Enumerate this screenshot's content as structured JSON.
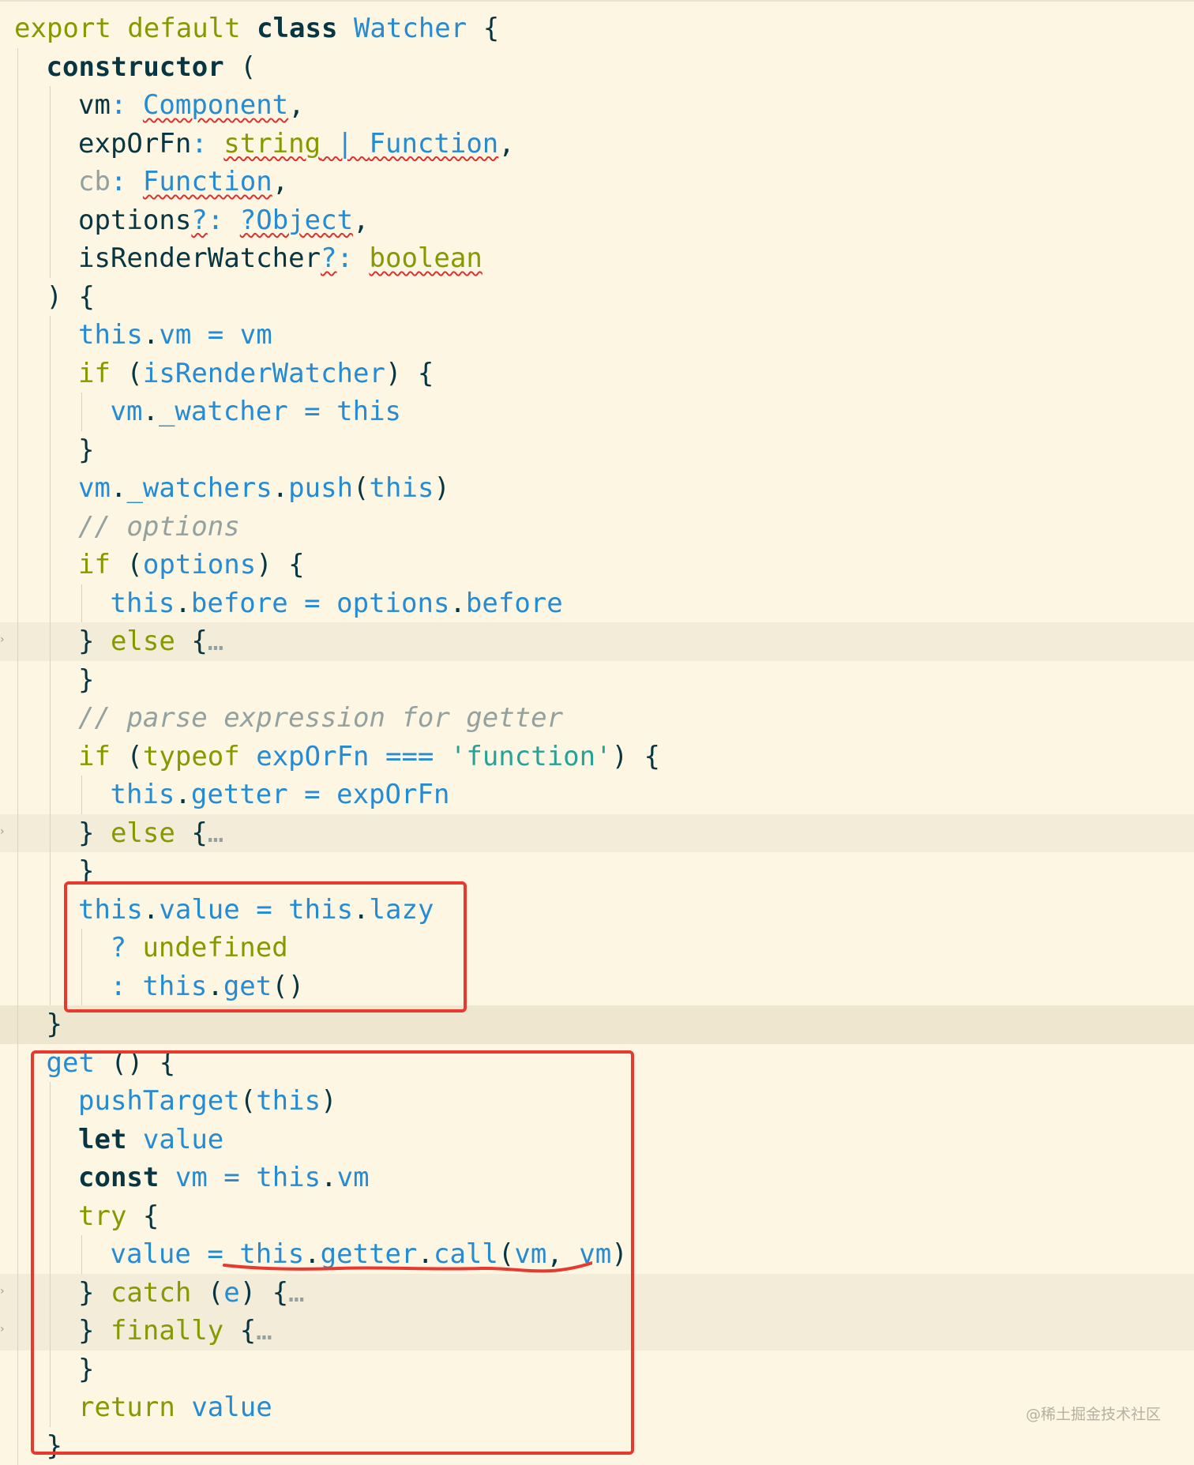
{
  "editor": {
    "language": "JavaScript (Flow)",
    "theme_background": "#fdf6e3",
    "lines": [
      {
        "n": 1,
        "indent": 0,
        "tokens": [
          [
            "kw",
            "export"
          ],
          [
            "pl",
            " "
          ],
          [
            "kw",
            "default"
          ],
          [
            "pl",
            " "
          ],
          [
            "bld",
            "class"
          ],
          [
            "pl",
            " "
          ],
          [
            "ty",
            "Watcher"
          ],
          [
            "pl",
            " {"
          ]
        ]
      },
      {
        "n": 2,
        "indent": 1,
        "tokens": [
          [
            "bld",
            "constructor"
          ],
          [
            "pl",
            " ("
          ]
        ]
      },
      {
        "n": 3,
        "indent": 2,
        "tokens": [
          [
            "pl",
            "vm"
          ],
          [
            "op",
            ":"
          ],
          [
            "pl",
            " "
          ],
          [
            "ty",
            "Component",
            "sq"
          ],
          [
            "pl",
            ","
          ]
        ]
      },
      {
        "n": 4,
        "indent": 2,
        "tokens": [
          [
            "pl",
            "expOrFn"
          ],
          [
            "op",
            ":"
          ],
          [
            "pl",
            " "
          ],
          [
            "yel",
            "string",
            "sq"
          ],
          [
            "op",
            " | ",
            "sq"
          ],
          [
            "ty",
            "Function",
            "sq"
          ],
          [
            "pl",
            ","
          ]
        ]
      },
      {
        "n": 5,
        "indent": 2,
        "tokens": [
          [
            "dim",
            "cb"
          ],
          [
            "op",
            ":"
          ],
          [
            "pl",
            " "
          ],
          [
            "ty",
            "Function",
            "sq"
          ],
          [
            "pl",
            ","
          ]
        ]
      },
      {
        "n": 6,
        "indent": 2,
        "tokens": [
          [
            "pl",
            "options"
          ],
          [
            "op",
            "?",
            "sq"
          ],
          [
            "op",
            ":"
          ],
          [
            "pl",
            " "
          ],
          [
            "ty",
            "?Object",
            "sq"
          ],
          [
            "pl",
            ","
          ]
        ]
      },
      {
        "n": 7,
        "indent": 2,
        "tokens": [
          [
            "pl",
            "isRenderWatcher"
          ],
          [
            "op",
            "?",
            "sq"
          ],
          [
            "op",
            ":"
          ],
          [
            "pl",
            " "
          ],
          [
            "yel",
            "boolean",
            "sq"
          ]
        ]
      },
      {
        "n": 8,
        "indent": 1,
        "tokens": [
          [
            "pl",
            ") {"
          ]
        ]
      },
      {
        "n": 9,
        "indent": 2,
        "tokens": [
          [
            "id",
            "this"
          ],
          [
            "pl",
            "."
          ],
          [
            "id",
            "vm"
          ],
          [
            "op",
            " = "
          ],
          [
            "id",
            "vm"
          ]
        ]
      },
      {
        "n": 10,
        "indent": 2,
        "tokens": [
          [
            "kw",
            "if"
          ],
          [
            "pl",
            " ("
          ],
          [
            "id",
            "isRenderWatcher"
          ],
          [
            "pl",
            ") {"
          ]
        ]
      },
      {
        "n": 11,
        "indent": 3,
        "tokens": [
          [
            "id",
            "vm"
          ],
          [
            "pl",
            "."
          ],
          [
            "id",
            "_watcher"
          ],
          [
            "op",
            " = "
          ],
          [
            "id",
            "this"
          ]
        ]
      },
      {
        "n": 12,
        "indent": 2,
        "tokens": [
          [
            "pl",
            "}"
          ]
        ]
      },
      {
        "n": 13,
        "indent": 2,
        "tokens": [
          [
            "id",
            "vm"
          ],
          [
            "pl",
            "."
          ],
          [
            "id",
            "_watchers"
          ],
          [
            "pl",
            "."
          ],
          [
            "id",
            "push"
          ],
          [
            "pl",
            "("
          ],
          [
            "id",
            "this"
          ],
          [
            "pl",
            ")"
          ]
        ]
      },
      {
        "n": 14,
        "indent": 2,
        "tokens": [
          [
            "cmt",
            "// options"
          ]
        ]
      },
      {
        "n": 15,
        "indent": 2,
        "tokens": [
          [
            "kw",
            "if"
          ],
          [
            "pl",
            " ("
          ],
          [
            "id",
            "options"
          ],
          [
            "pl",
            ") {"
          ]
        ]
      },
      {
        "n": 16,
        "indent": 3,
        "tokens": [
          [
            "id",
            "this"
          ],
          [
            "pl",
            "."
          ],
          [
            "id",
            "before"
          ],
          [
            "op",
            " = "
          ],
          [
            "id",
            "options"
          ],
          [
            "pl",
            "."
          ],
          [
            "id",
            "before"
          ]
        ]
      },
      {
        "n": 17,
        "indent": 2,
        "folded": true,
        "tokens": [
          [
            "pl",
            "} "
          ],
          [
            "kw",
            "else"
          ],
          [
            "pl",
            " {"
          ],
          [
            "dim",
            "…"
          ]
        ]
      },
      {
        "n": 18,
        "indent": 2,
        "tokens": [
          [
            "pl",
            "}"
          ]
        ]
      },
      {
        "n": 19,
        "indent": 2,
        "tokens": [
          [
            "cmt",
            "// parse expression for getter"
          ]
        ]
      },
      {
        "n": 20,
        "indent": 2,
        "tokens": [
          [
            "kw",
            "if"
          ],
          [
            "pl",
            " ("
          ],
          [
            "kw",
            "typeof"
          ],
          [
            "pl",
            " "
          ],
          [
            "id",
            "expOrFn"
          ],
          [
            "op",
            " === "
          ],
          [
            "str",
            "'function'"
          ],
          [
            "pl",
            ") {"
          ]
        ]
      },
      {
        "n": 21,
        "indent": 3,
        "tokens": [
          [
            "id",
            "this"
          ],
          [
            "pl",
            "."
          ],
          [
            "id",
            "getter"
          ],
          [
            "op",
            " = "
          ],
          [
            "id",
            "expOrFn"
          ]
        ]
      },
      {
        "n": 22,
        "indent": 2,
        "folded": true,
        "tokens": [
          [
            "pl",
            "} "
          ],
          [
            "kw",
            "else"
          ],
          [
            "pl",
            " {"
          ],
          [
            "dim",
            "…"
          ]
        ]
      },
      {
        "n": 23,
        "indent": 2,
        "tokens": [
          [
            "pl",
            "}"
          ]
        ]
      },
      {
        "n": 24,
        "indent": 2,
        "tokens": [
          [
            "id",
            "this"
          ],
          [
            "pl",
            "."
          ],
          [
            "id",
            "value"
          ],
          [
            "op",
            " = "
          ],
          [
            "id",
            "this"
          ],
          [
            "pl",
            "."
          ],
          [
            "id",
            "lazy"
          ]
        ]
      },
      {
        "n": 25,
        "indent": 3,
        "tokens": [
          [
            "op",
            "? "
          ],
          [
            "yel",
            "undefined"
          ]
        ]
      },
      {
        "n": 26,
        "indent": 3,
        "tokens": [
          [
            "op",
            ": "
          ],
          [
            "id",
            "this"
          ],
          [
            "pl",
            "."
          ],
          [
            "id",
            "get"
          ],
          [
            "pl",
            "()"
          ]
        ]
      },
      {
        "n": 27,
        "indent": 1,
        "foldEnd": true,
        "tokens": [
          [
            "pl",
            "}"
          ]
        ]
      },
      {
        "n": 28,
        "indent": 1,
        "tokens": [
          [
            "id",
            "get"
          ],
          [
            "pl",
            " () {"
          ]
        ]
      },
      {
        "n": 29,
        "indent": 2,
        "tokens": [
          [
            "id",
            "pushTarget"
          ],
          [
            "pl",
            "("
          ],
          [
            "id",
            "this"
          ],
          [
            "pl",
            ")"
          ]
        ]
      },
      {
        "n": 30,
        "indent": 2,
        "tokens": [
          [
            "bld",
            "let"
          ],
          [
            "pl",
            " "
          ],
          [
            "id",
            "value"
          ]
        ]
      },
      {
        "n": 31,
        "indent": 2,
        "tokens": [
          [
            "bld",
            "const"
          ],
          [
            "pl",
            " "
          ],
          [
            "id",
            "vm"
          ],
          [
            "op",
            " = "
          ],
          [
            "id",
            "this"
          ],
          [
            "pl",
            "."
          ],
          [
            "id",
            "vm"
          ]
        ]
      },
      {
        "n": 32,
        "indent": 2,
        "tokens": [
          [
            "kw",
            "try"
          ],
          [
            "pl",
            " {"
          ]
        ]
      },
      {
        "n": 33,
        "indent": 3,
        "tokens": [
          [
            "id",
            "value"
          ],
          [
            "op",
            " = "
          ],
          [
            "id",
            "this"
          ],
          [
            "pl",
            "."
          ],
          [
            "id",
            "getter"
          ],
          [
            "pl",
            "."
          ],
          [
            "id",
            "call"
          ],
          [
            "pl",
            "("
          ],
          [
            "id",
            "vm"
          ],
          [
            "pl",
            ", "
          ],
          [
            "id",
            "vm"
          ],
          [
            "pl",
            ")"
          ]
        ]
      },
      {
        "n": 34,
        "indent": 2,
        "folded": true,
        "tokens": [
          [
            "pl",
            "} "
          ],
          [
            "kw",
            "catch"
          ],
          [
            "pl",
            " ("
          ],
          [
            "id",
            "e"
          ],
          [
            "pl",
            ") {"
          ],
          [
            "dim",
            "…"
          ]
        ]
      },
      {
        "n": 35,
        "indent": 2,
        "folded": true,
        "tokens": [
          [
            "pl",
            "} "
          ],
          [
            "kw",
            "finally"
          ],
          [
            "pl",
            " {"
          ],
          [
            "dim",
            "…"
          ]
        ]
      },
      {
        "n": 36,
        "indent": 2,
        "tokens": [
          [
            "pl",
            "}"
          ]
        ]
      },
      {
        "n": 37,
        "indent": 2,
        "tokens": [
          [
            "kw",
            "return"
          ],
          [
            "pl",
            " "
          ],
          [
            "id",
            "value"
          ]
        ]
      },
      {
        "n": 38,
        "indent": 1,
        "tokens": [
          [
            "pl",
            "}"
          ]
        ]
      }
    ]
  },
  "annotations": {
    "highlight_box_color": "#e8392f",
    "boxes": [
      "lazy-value-assignment",
      "get-method"
    ],
    "underlined_text": "this.getter.call(vm, vm)"
  },
  "watermark": "@稀土掘金技术社区"
}
